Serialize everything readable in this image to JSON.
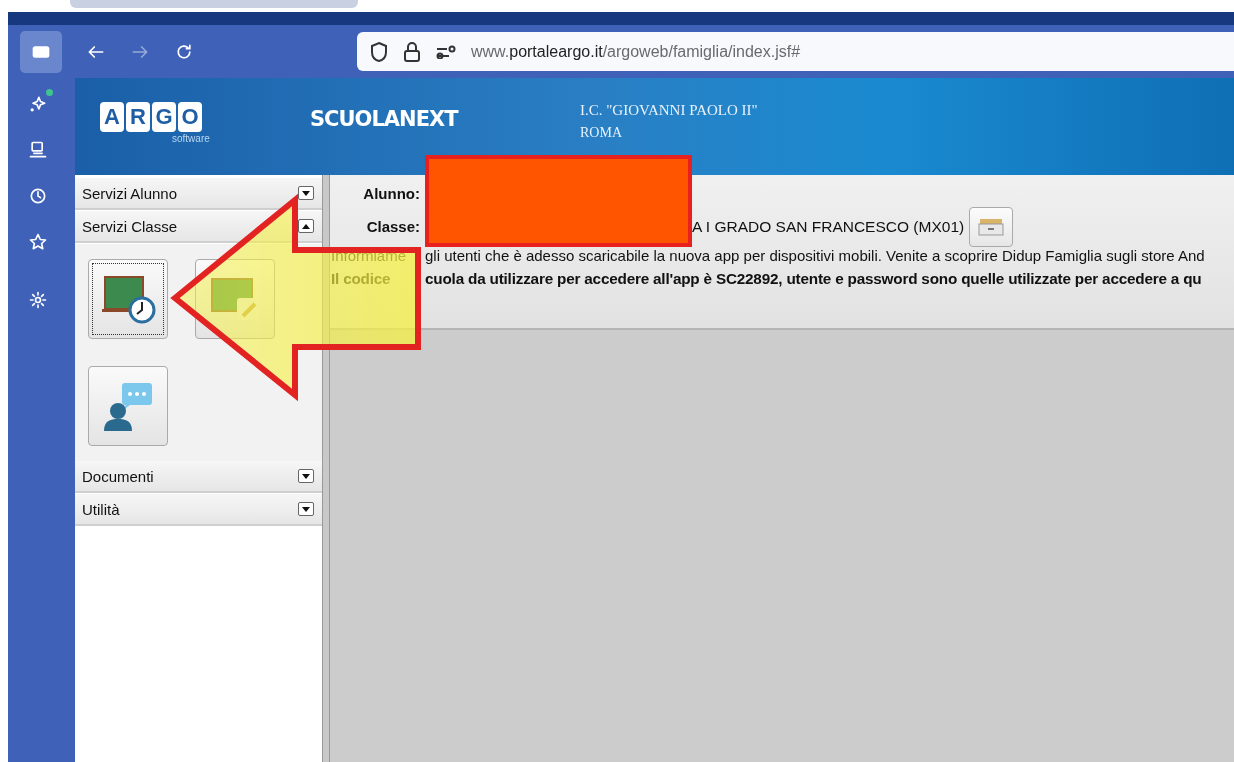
{
  "browser": {
    "toolbar": [
      {
        "kind": "sidebar",
        "active": true,
        "disabled": false
      },
      {
        "kind": "back",
        "active": false,
        "disabled": false
      },
      {
        "kind": "forward",
        "active": false,
        "disabled": true
      },
      {
        "kind": "reload",
        "active": false,
        "disabled": false
      }
    ],
    "address": {
      "url_prefix": "www.",
      "url_host": "portaleargo.it",
      "url_path": "/argoweb/famiglia/index.jsf#"
    },
    "sidebar": [
      {
        "kind": "sparkle",
        "badge": true
      },
      {
        "kind": "device",
        "badge": false
      },
      {
        "kind": "history",
        "badge": false
      },
      {
        "kind": "star",
        "badge": false
      },
      {
        "kind": "settings",
        "badge": false
      }
    ]
  },
  "header": {
    "logo": [
      "A",
      "R",
      "G",
      "O"
    ],
    "logo_sub": "software",
    "product": "SCUOLANEXT",
    "school": "I.C. \"GIOVANNI PAOLO II\"",
    "city": "ROMA"
  },
  "menu": [
    {
      "label": "Servizi Alunno",
      "expanded": false
    },
    {
      "label": "Servizi Classe",
      "expanded": true,
      "tiles": [
        {
          "kind": "timetable",
          "selected": true
        },
        {
          "kind": "board",
          "selected": false
        },
        {
          "kind": "chat",
          "selected": false
        }
      ]
    },
    {
      "label": "Documenti",
      "expanded": false
    },
    {
      "label": "Utilità",
      "expanded": false
    }
  ],
  "student": {
    "label": "Alunno:"
  },
  "class": {
    "label": "Classe:",
    "value": "A I GRADO SAN FRANCESCO (MX01)"
  },
  "notice": [
    {
      "before": "Informiame",
      "after": "gli utenti che è adesso scaricabile la nuova app per dispositivi mobili. Venite a scoprire Didup Famiglia sugli store And",
      "bold": false
    },
    {
      "before": "Il codice",
      "after": "cuola da utilizzare per accedere all'app è SC22892, utente e password sono quelle utilizzate per accedere a qu",
      "bold": true
    }
  ]
}
